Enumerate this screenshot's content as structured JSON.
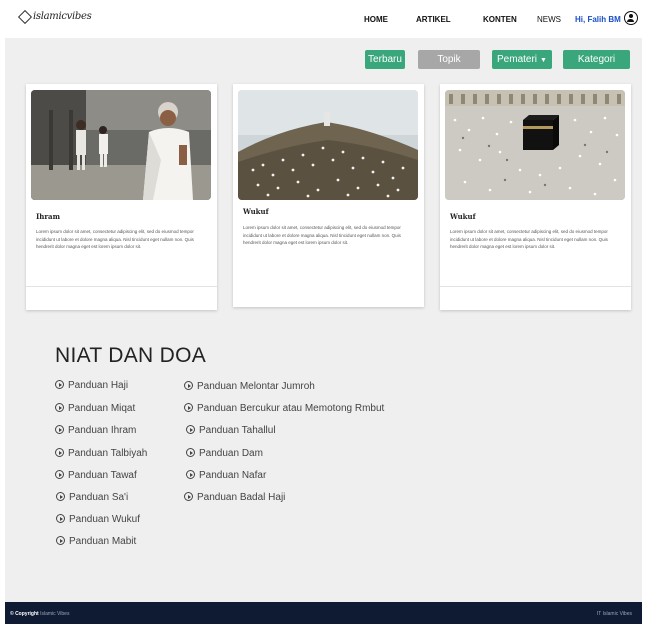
{
  "brand": {
    "logo_text": "islamicvibes"
  },
  "nav": {
    "items": [
      "HOME",
      "ARTIKEL",
      "KONTEN",
      "NEWS"
    ],
    "user_label": "Hi, Falih BM"
  },
  "filters": {
    "terbaru": "Terbaru",
    "topik": "Topik",
    "pemateri": "Pemateri",
    "kategori": "Kategori",
    "accent_color": "#3aa67b",
    "inactive_color": "#a7a7a7"
  },
  "cards": [
    {
      "title": "Ihram",
      "text": "Lorem ipsum dolor sit amet, consectetur adipiscing elit, sed do eiusmod tempor incididunt ut labore et dolore magna aliqua. Nisl tincidunt eget nullam non. Quis hendrerit dolor magna eget est lorem ipsum dolor sit."
    },
    {
      "title": "Wukuf",
      "text": "Lorem ipsum dolor sit amet, consectetur adipiscing elit, sed do eiusmod tempor incididunt ut labore et dolore magna aliqua. Nisl tincidunt eget nullam non. Quis hendrerit dolor magna eget est lorem ipsum dolor sit."
    },
    {
      "title": "Wukuf",
      "text": "Lorem ipsum dolor sit amet, consectetur adipiscing elit, sed do eiusmod tempor incididunt ut labore et dolore magna aliqua. Nisl tincidunt eget nullam non. Quis hendrerit dolor magna eget est lorem ipsum dolor sit."
    }
  ],
  "section": {
    "title": "NIAT DAN DOA",
    "guides_left": [
      "Panduan Haji",
      "Panduan Miqat",
      "Panduan Ihram",
      "Panduan Talbiyah",
      "Panduan Tawaf",
      "Panduan Sa'i",
      "Panduan Wukuf",
      "Panduan Mabit"
    ],
    "guides_right": [
      "Panduan Melontar Jumroh",
      "Panduan Bercukur atau Memotong Rmbut",
      "Panduan Tahallul",
      "Panduan Dam",
      "Panduan Nafar",
      "Panduan Badal Haji"
    ]
  },
  "footer": {
    "copyright_label": "© Copyright",
    "copyright_brand": "Islamic Vibes",
    "right_text": "IT Islamic Vibes"
  }
}
